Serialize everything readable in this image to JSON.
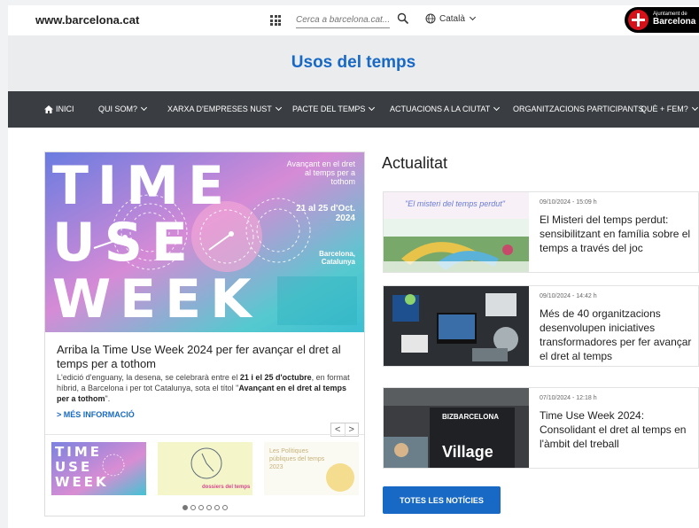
{
  "topbar": {
    "site_url": "www.barcelona.cat",
    "apps_icon": "grid-icon",
    "search_placeholder": "Cerca a barcelona.cat...",
    "search_icon": "search-icon",
    "language": "Català",
    "logo_line1": "Ajuntament de",
    "logo_line2": "Barcelona"
  },
  "band": {
    "title": "Usos del temps"
  },
  "nav": {
    "items": [
      {
        "label": "INICI",
        "icon": "home-icon"
      },
      {
        "label": "QUI SOM?",
        "dropdown": true
      },
      {
        "label": "XARXA D'EMPRESES NUST",
        "dropdown": true
      },
      {
        "label": "PACTE DEL TEMPS",
        "dropdown": true
      },
      {
        "label": "ACTUACIONS A LA CIUTAT",
        "dropdown": true
      },
      {
        "label": "ORGANITZACIONS PARTICIPANTS",
        "dropdown": false
      },
      {
        "label": "QUÈ + FEM?",
        "dropdown": true
      }
    ]
  },
  "feature": {
    "image": {
      "letters": [
        "TIME",
        "USE",
        "WEEK"
      ],
      "tagline": "Avançant en el dret al temps per a tothom",
      "date": "21 al 25 d'Oct. 2024",
      "city": "Barcelona, Catalunya"
    },
    "title": "Arriba la Time Use Week 2024 per fer avançar el dret al temps per a tothom",
    "desc_1": "L'edició d'enguany, la desena, se celebrarà entre el ",
    "desc_bold_1": "21 i el 25 d'octubre",
    "desc_2": ", en format híbrid, a Barcelona i per tot Catalunya, sota el títol \"",
    "desc_bold_2": "Avançant en el dret al temps per a tothom",
    "desc_3": "\".",
    "more_link": "> MÉS INFORMACIÓ",
    "prev_label": "<",
    "next_label": ">",
    "thumbs": [
      {
        "label": "TIME USE WEEK"
      },
      {
        "label": "dossiers del temps"
      },
      {
        "label": "Les Polítiques públiques del temps 2023"
      }
    ],
    "dots_total": 6,
    "dots_active": 1
  },
  "news": {
    "heading": "Actualitat",
    "items": [
      {
        "date": "09/10/2024 - 15:09 h",
        "title": "El Misteri del temps perdut: sensibilitzant en família sobre el temps a través del joc",
        "thumb_caption": "\"El misteri del temps perdut\""
      },
      {
        "date": "09/10/2024 - 14:42 h",
        "title": "Més de 40 organitzacions desenvolupen iniciatives transformadores per fer avançar el dret al temps"
      },
      {
        "date": "07/10/2024 - 12:18 h",
        "title": "Time Use Week 2024: Consolidant el dret al temps en l'àmbit del treball",
        "thumb_caption_1": "BIZBARCELONA",
        "thumb_caption_2": "Village"
      }
    ],
    "all_button": "TOTES LES NOTÍCIES"
  },
  "colors": {
    "brand_blue": "#1769c5",
    "nav_bg": "#3a3d41",
    "logo_red": "#d5121a"
  }
}
